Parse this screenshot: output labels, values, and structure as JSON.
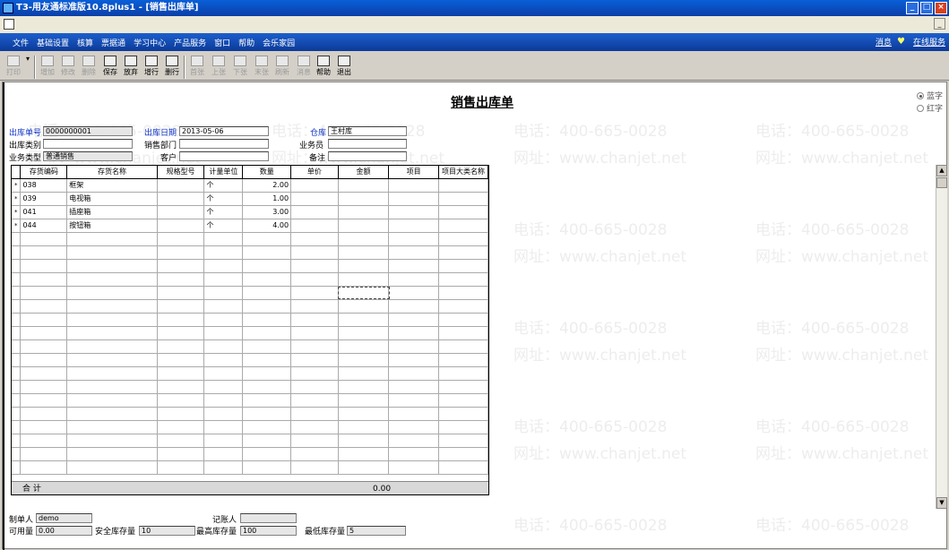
{
  "window": {
    "title": "T3-用友通标准版10.8plus1 - [销售出库单]"
  },
  "menubar": {
    "items": [
      "文件",
      "基础设置",
      "核算",
      "票据通",
      "学习中心",
      "产品服务",
      "窗口",
      "帮助",
      "会乐家园"
    ],
    "right_news": "消息",
    "right_service": "在线服务"
  },
  "toolbar": {
    "print": "打印",
    "add": "增加",
    "modify": "修改",
    "delete": "删除",
    "save": "保存",
    "discard": "放弃",
    "add_row": "增行",
    "del_row": "删行",
    "first": "首张",
    "prev": "上张",
    "next": "下张",
    "last": "末张",
    "refresh": "刷新",
    "message": "消息",
    "help": "帮助",
    "exit": "退出"
  },
  "form": {
    "title": "销售出库单",
    "radio_blue": "蓝字",
    "radio_red": "红字",
    "doc_no_label": "出库单号",
    "doc_no": "0000000001",
    "date_label": "出库日期",
    "date": "2013-05-06",
    "warehouse_label": "仓库",
    "warehouse": "王村库",
    "out_type_label": "出库类别",
    "out_type": "",
    "dept_label": "销售部门",
    "dept": "",
    "salesman_label": "业务员",
    "salesman": "",
    "biz_type_label": "业务类型",
    "biz_type": "普通销售",
    "customer_label": "客户",
    "customer": "",
    "remark_label": "备注",
    "remark": ""
  },
  "grid": {
    "columns": [
      "存货编码",
      "存货名称",
      "规格型号",
      "计量单位",
      "数量",
      "单价",
      "金额",
      "项目",
      "项目大类名称"
    ],
    "rows": [
      {
        "mark": "*",
        "code": "038",
        "name": "框架",
        "spec": "",
        "unit": "个",
        "qty": "2.00",
        "price": "",
        "amount": "",
        "project": "",
        "category": ""
      },
      {
        "mark": "*",
        "code": "039",
        "name": "电视箱",
        "spec": "",
        "unit": "个",
        "qty": "1.00",
        "price": "",
        "amount": "",
        "project": "",
        "category": ""
      },
      {
        "mark": "*",
        "code": "041",
        "name": "插座箱",
        "spec": "",
        "unit": "个",
        "qty": "3.00",
        "price": "",
        "amount": "",
        "project": "",
        "category": ""
      },
      {
        "mark": "*",
        "code": "044",
        "name": "按钮箱",
        "spec": "",
        "unit": "个",
        "qty": "4.00",
        "price": "",
        "amount": "",
        "project": "",
        "category": ""
      }
    ],
    "total_label": "合 计",
    "total_amount": "0.00"
  },
  "footer": {
    "maker_label": "制单人",
    "maker": "demo",
    "bookkeeper_label": "记账人",
    "bookkeeper": "",
    "available_label": "可用量",
    "available": "0.00",
    "safety_label": "安全库存量",
    "safety": "10",
    "max_label": "最高库存量",
    "max": "100",
    "min_label": "最低库存量",
    "min": "5"
  },
  "watermark": {
    "phone": "电话：400-665-0028",
    "site": "网址：www.chanjet.net"
  }
}
